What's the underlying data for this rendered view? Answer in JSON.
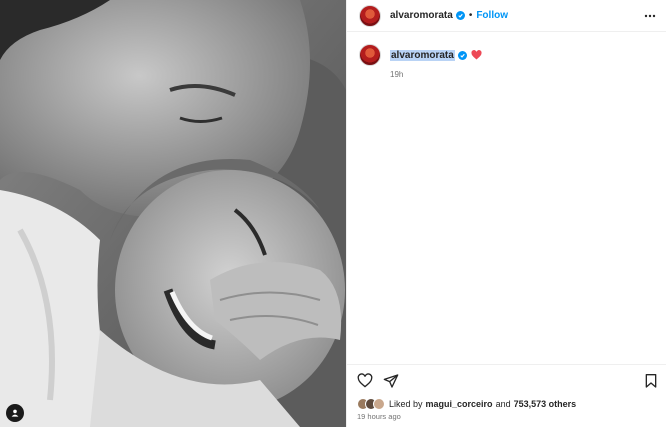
{
  "post": {
    "author": {
      "username": "alvaromorata",
      "verified_icon": "verified-badge-icon",
      "follow_label": "Follow",
      "separator": "•"
    },
    "caption": {
      "username": "alvaromorata",
      "emoji_icon": "red-heart-icon",
      "relative_time": "19h"
    },
    "actions": {
      "like_icon": "heart-outline-icon",
      "share_icon": "paper-plane-icon",
      "save_icon": "bookmark-icon",
      "more_icon": "more-horizontal-icon",
      "tag_icon": "user-tag-icon"
    },
    "likes": {
      "prefix": "Liked by",
      "liker": "magui_corceiro",
      "joiner": "and",
      "others": "753,573 others"
    },
    "timestamp": "19 hours ago",
    "colors": {
      "accent": "#0095f6",
      "heart": "#ed4956",
      "text": "#262626",
      "secondary_text": "#737373",
      "highlight": "#b9d3f5"
    }
  }
}
